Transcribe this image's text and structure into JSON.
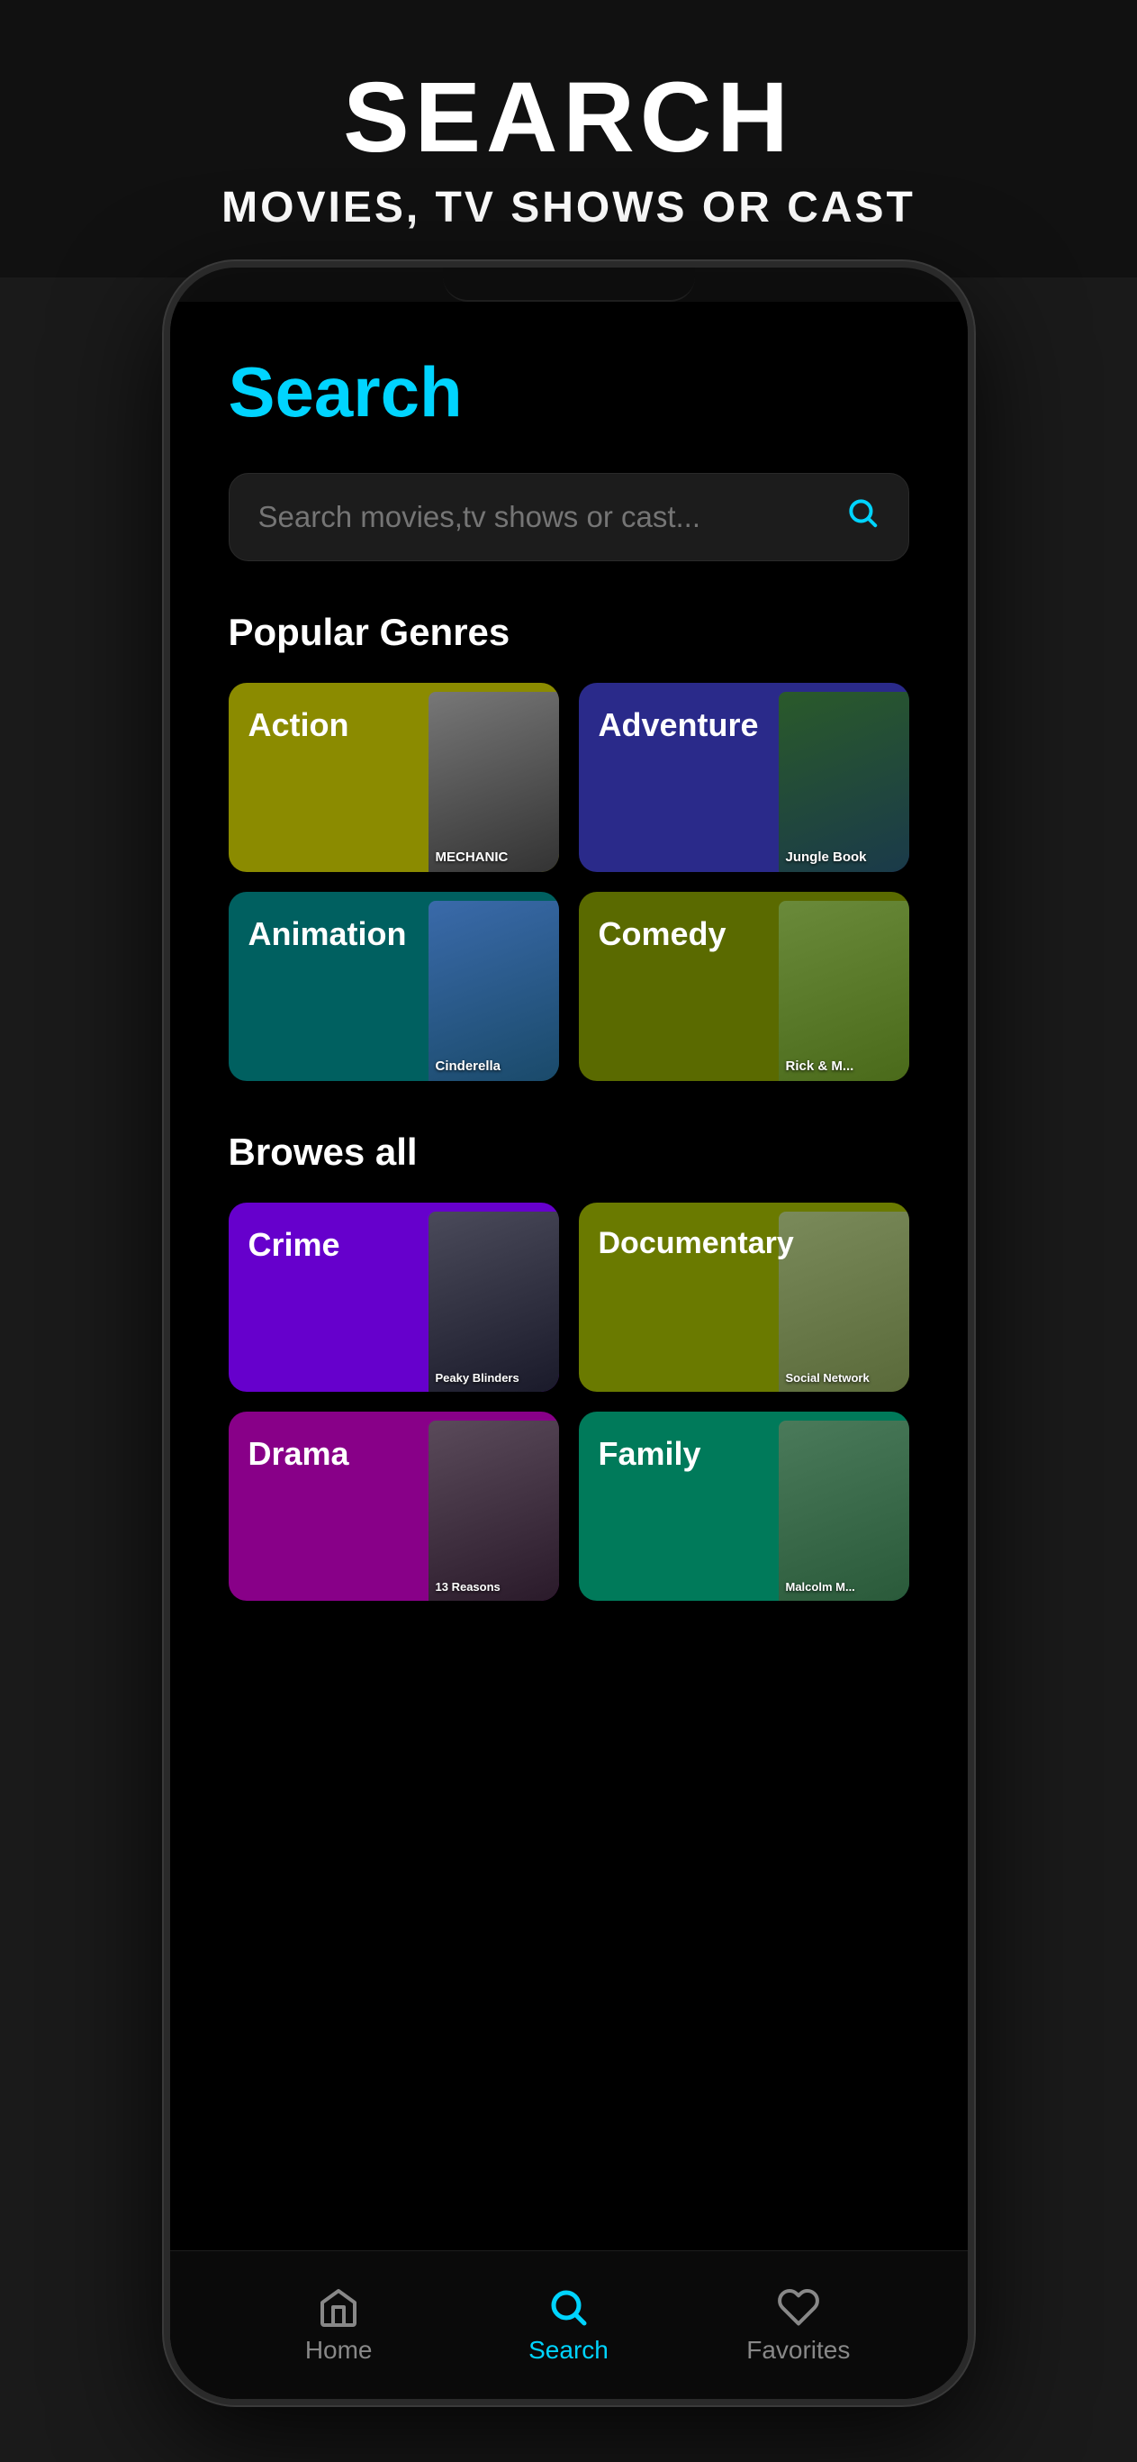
{
  "banner": {
    "title": "SEARCH",
    "subtitle": "MOVIES, TV SHOWS OR CAST"
  },
  "screen": {
    "search_heading": "Search",
    "search_placeholder": "Search movies,tv shows or cast...",
    "popular_genres_label": "Popular Genres",
    "browses_all_label": "Browes all",
    "genres_popular": [
      {
        "id": "action",
        "label": "Action",
        "css_class": "card-action",
        "poster_css": "poster-action",
        "poster_text": "MECHANIC"
      },
      {
        "id": "adventure",
        "label": "Adventure",
        "css_class": "card-adventure",
        "poster_css": "poster-adventure",
        "poster_text": "Jungle Book"
      },
      {
        "id": "animation",
        "label": "Animation",
        "css_class": "card-animation",
        "poster_css": "poster-animation",
        "poster_text": "Cinderella"
      },
      {
        "id": "comedy",
        "label": "Comedy",
        "css_class": "card-comedy",
        "poster_css": "poster-comedy",
        "poster_text": "Rick & M"
      }
    ],
    "genres_all": [
      {
        "id": "crime",
        "label": "Crime",
        "css_class": "card-crime",
        "poster_css": "poster-crime",
        "poster_text": "Peaky Blinders"
      },
      {
        "id": "documentary",
        "label": "Documentary",
        "css_class": "card-documentary",
        "poster_css": "poster-documentary",
        "poster_text": "Social Network"
      },
      {
        "id": "drama",
        "label": "Drama",
        "css_class": "card-drama",
        "poster_css": "poster-drama",
        "poster_text": "13 Reasons"
      },
      {
        "id": "family",
        "label": "Family",
        "css_class": "card-family",
        "poster_css": "poster-family",
        "poster_text": "Malcolm M"
      }
    ]
  },
  "bottom_nav": {
    "items": [
      {
        "id": "home",
        "label": "Home",
        "icon": "⌂",
        "active": false
      },
      {
        "id": "search",
        "label": "Search",
        "icon": "⌕",
        "active": true
      },
      {
        "id": "favorites",
        "label": "Favorites",
        "icon": "♡",
        "active": false
      }
    ]
  }
}
